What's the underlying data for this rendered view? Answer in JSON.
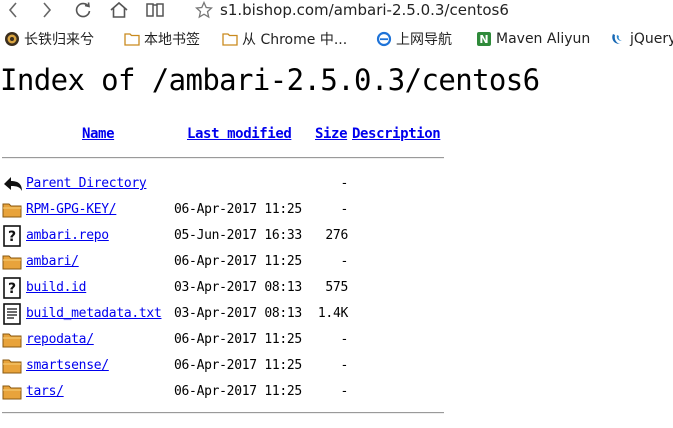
{
  "browser": {
    "address": "s1.bishop.com/ambari-2.5.0.3/centos6",
    "bookmarks": [
      {
        "label": "长铁归来兮",
        "icon": "bookmark-site-icon"
      },
      {
        "label": "本地书签",
        "icon": "folder-icon"
      },
      {
        "label": "从 Chrome 中...",
        "icon": "folder-icon"
      },
      {
        "label": "上网导航",
        "icon": "ie-icon"
      },
      {
        "label": "Maven Aliyun",
        "icon": "nexus-icon"
      },
      {
        "label": "jQuery",
        "icon": "jquery-icon"
      }
    ],
    "accent_color": "#0000ee",
    "folder_color": "#e8a33b"
  },
  "page": {
    "title": "Index of /ambari-2.5.0.3/centos6",
    "columns": {
      "name": "Name",
      "last_modified": "Last modified",
      "size": "Size",
      "description": "Description"
    },
    "rows": [
      {
        "icon": "back-icon",
        "name": "Parent Directory",
        "modified": "",
        "size": "-"
      },
      {
        "icon": "folder-icon",
        "name": "RPM-GPG-KEY/",
        "modified": "06-Apr-2017 11:25",
        "size": "-"
      },
      {
        "icon": "unknown-file-icon",
        "name": "ambari.repo",
        "modified": "05-Jun-2017 16:33",
        "size": "276"
      },
      {
        "icon": "folder-icon",
        "name": "ambari/",
        "modified": "06-Apr-2017 11:25",
        "size": "-"
      },
      {
        "icon": "unknown-file-icon",
        "name": "build.id",
        "modified": "03-Apr-2017 08:13",
        "size": "575"
      },
      {
        "icon": "text-file-icon",
        "name": "build_metadata.txt",
        "modified": "03-Apr-2017 08:13",
        "size": "1.4K"
      },
      {
        "icon": "folder-icon",
        "name": "repodata/",
        "modified": "06-Apr-2017 11:25",
        "size": "-"
      },
      {
        "icon": "folder-icon",
        "name": "smartsense/",
        "modified": "06-Apr-2017 11:25",
        "size": "-"
      },
      {
        "icon": "folder-icon",
        "name": "tars/",
        "modified": "06-Apr-2017 11:25",
        "size": "-"
      }
    ]
  }
}
